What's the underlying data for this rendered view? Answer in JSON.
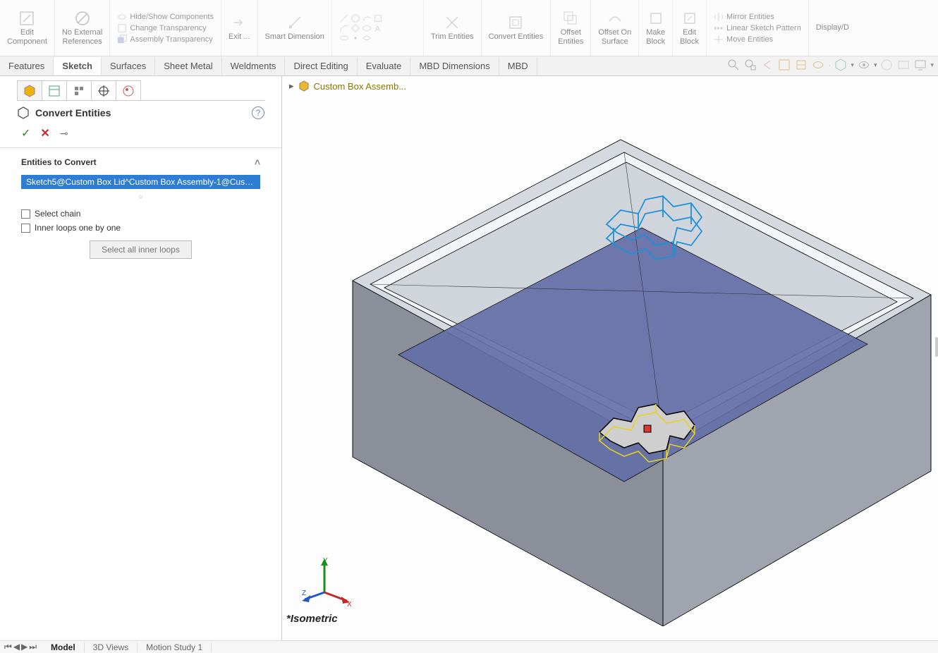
{
  "ribbon": {
    "edit_component": "Edit\nComponent",
    "no_ext_ref": "No External\nReferences",
    "hideshow": "Hide/Show Components",
    "changetrans": "Change Transparency",
    "assmtrans": "Assembly Transparency",
    "exit": "Exit ...",
    "smart_dim": "Smart Dimension",
    "trim": "Trim Entities",
    "convert": "Convert Entities",
    "offset": "Offset\nEntities",
    "offset_surf": "Offset On\nSurface",
    "make_block": "Make\nBlock",
    "edit_block": "Edit\nBlock",
    "mirror": "Mirror Entities",
    "lsp": "Linear Sketch Pattern",
    "move": "Move Entities",
    "display": "Display/D"
  },
  "tabs": [
    "Features",
    "Sketch",
    "Surfaces",
    "Sheet Metal",
    "Weldments",
    "Direct Editing",
    "Evaluate",
    "MBD Dimensions",
    "MBD"
  ],
  "active_tab": "Sketch",
  "panel": {
    "title": "Convert Entities",
    "section": "Entities to Convert",
    "selection": "Sketch5@Custom Box Lid^Custom Box Assembly-1@Cust…",
    "chk1": "Select chain",
    "chk2": "Inner loops one by one",
    "button": "Select all inner loops"
  },
  "breadcrumb": "Custom Box Assemb...",
  "view_label": "*Isometric",
  "bottom_tabs": {
    "model": "Model",
    "views3d": "3D Views",
    "motion": "Motion Study 1"
  }
}
